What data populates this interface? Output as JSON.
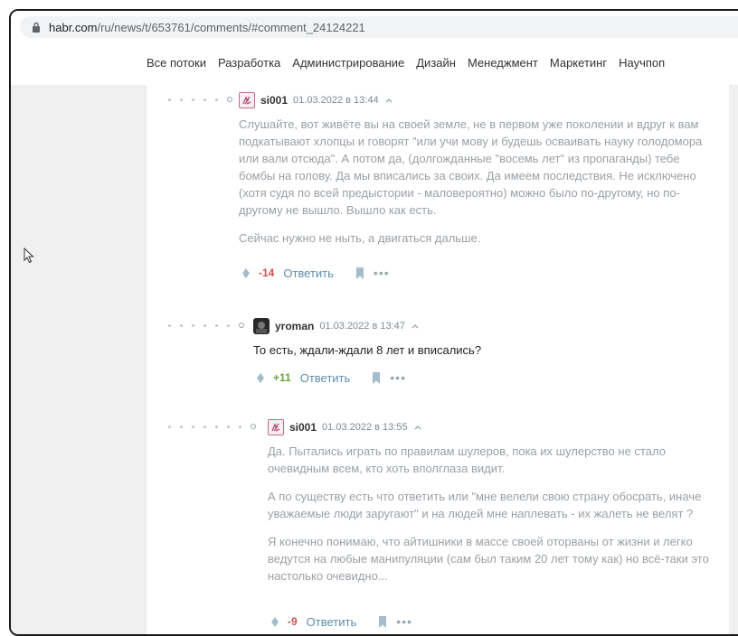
{
  "browser": {
    "url_host": "habr.com",
    "url_path": "/ru/news/t/653761/comments/#comment_24124221"
  },
  "nav": {
    "items": [
      "Все потоки",
      "Разработка",
      "Администрирование",
      "Дизайн",
      "Менеджмент",
      "Маркетинг",
      "Научпоп"
    ]
  },
  "comments": [
    {
      "username": "si001",
      "time": "01.03.2022 в 13:44",
      "paragraphs": [
        "Слушайте, вот живёте вы на своей земле, не в первом уже поколении и вдруг к вам подкатывают хлопцы и говорят \"или учи мову и будешь осваивать науку голодомора или вали отсюда\". А потом да, (долгожданные \"восемь лет\" из пропаганды) тебе бомбы на голову. Да мы вписались за своих. Да имеем последствия. Не исключено (хотя судя по всей предыстории - маловероятно) можно было по-другому, но по-другому не вышло. Вышло как есть.",
        "Сейчас нужно не ныть, а двигаться дальше."
      ],
      "score": "-14",
      "reply_label": "Ответить"
    },
    {
      "username": "yroman",
      "time": "01.03.2022 в 13:47",
      "paragraphs": [
        "То есть, ждали-ждали 8 лет и вписались?"
      ],
      "score": "+11",
      "reply_label": "Ответить"
    },
    {
      "username": "si001",
      "time": "01.03.2022 в 13:55",
      "paragraphs": [
        "Да. Пытались играть по правилам шулеров, пока их шулерство не стало очевидным всем, кто хоть вполглаза видит.",
        "А по существу есть что ответить или \"мне велели свою страну обосрать, иначе уважаемые люди заругают\" и на людей мне наплевать - их жалеть не велят ?",
        "Я конечно понимаю, что айтишники в массе своей оторваны от жизни и легко ведутся на любые манипуляции (сам был таким 20 лет тому как) но всё-таки это настолько очевидно..."
      ],
      "score": "-9",
      "reply_label": "Ответить"
    }
  ],
  "colors": {
    "negative": "#d04e4e",
    "positive": "#6aa339",
    "link": "#5e8eac",
    "muted_text": "#9aa0a6"
  }
}
